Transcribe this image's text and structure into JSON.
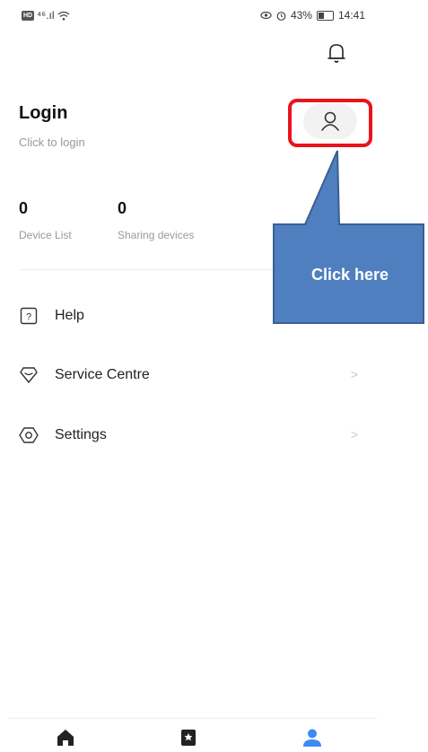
{
  "status_bar": {
    "left_badge": "HD",
    "left_signal": "⁴⁶.ıl",
    "battery_percent": "43%",
    "battery_level": 0.43,
    "time": "14:41"
  },
  "profile": {
    "title": "Login",
    "subtitle": "Click to login"
  },
  "stats": [
    {
      "value": "0",
      "label": "Device List"
    },
    {
      "value": "0",
      "label": "Sharing devices"
    }
  ],
  "menu": [
    {
      "label": "Help",
      "icon": "help-icon",
      "chevron": ""
    },
    {
      "label": "Service Centre",
      "icon": "service-centre-icon",
      "chevron": ">"
    },
    {
      "label": "Settings",
      "icon": "settings-icon",
      "chevron": ">"
    }
  ],
  "annotation": {
    "callout_text": "Click here",
    "callout_color": "#4f7fbf",
    "highlight_color": "#e8141c"
  },
  "bottom_nav": [
    {
      "name": "home",
      "icon": "home-icon",
      "active": false
    },
    {
      "name": "scenes",
      "icon": "bookmark-icon",
      "active": false
    },
    {
      "name": "me",
      "icon": "user-icon",
      "active": true
    }
  ],
  "colors": {
    "accent": "#3d8bf2",
    "text_primary": "#111111",
    "text_secondary": "#999999"
  }
}
